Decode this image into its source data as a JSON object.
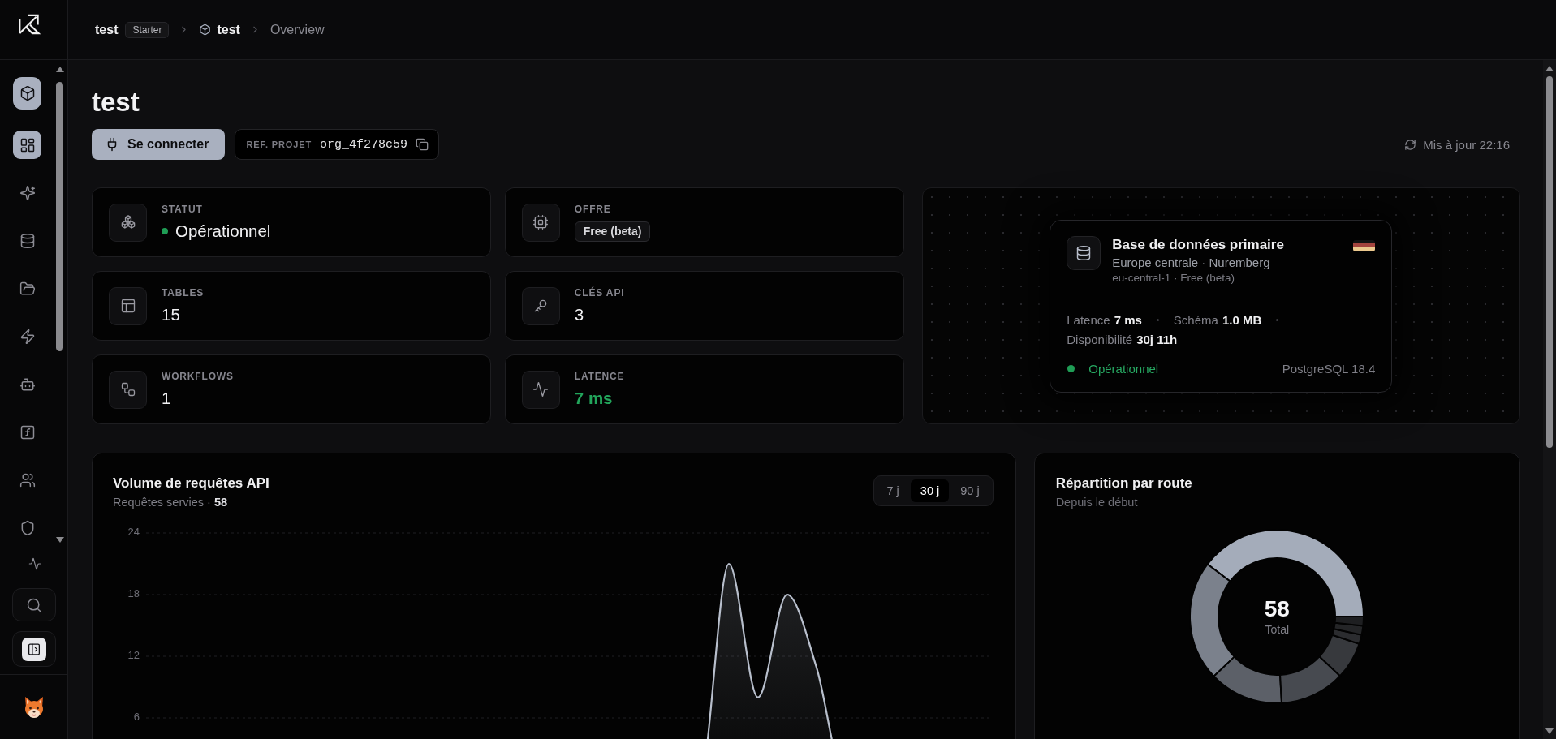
{
  "sidebar": {
    "nav": [
      {
        "selected": true
      },
      {
        "selected": true
      },
      {
        "selected": false
      },
      {
        "selected": false
      },
      {
        "selected": false
      },
      {
        "selected": false
      },
      {
        "selected": false
      },
      {
        "selected": false
      },
      {
        "selected": false
      },
      {
        "selected": false
      }
    ],
    "tools": [
      {
        "kind": "plain",
        "on": false
      },
      {
        "kind": "boxed",
        "on": false
      },
      {
        "kind": "boxed",
        "on": true
      }
    ]
  },
  "header": {
    "breadcrumb": {
      "org": "test",
      "plan": "Starter",
      "project": "test",
      "page": "Overview"
    }
  },
  "page": {
    "title": "test",
    "connect_button": "Se connecter",
    "project_ref": {
      "label": "RÉF. PROJET",
      "value": "org_4f278c59"
    },
    "updated": "Mis à jour 22:16"
  },
  "stats": [
    {
      "label": "STATUT",
      "value": "Opérationnel",
      "kind": "status"
    },
    {
      "label": "OFFRE",
      "value": "Free (beta)",
      "kind": "badge"
    },
    {
      "label": "TABLES",
      "value": "15",
      "kind": "plain"
    },
    {
      "label": "CLÉS API",
      "value": "3",
      "kind": "plain"
    },
    {
      "label": "WORKFLOWS",
      "value": "1",
      "kind": "plain"
    },
    {
      "label": "LATENCE",
      "value": "7 ms",
      "kind": "positive"
    }
  ],
  "database": {
    "title": "Base de données primaire",
    "location": "Europe centrale · Nuremberg",
    "region": "eu-central-1 · Free (beta)",
    "metrics": [
      {
        "label": "Latence",
        "value": "7 ms"
      },
      {
        "label": "Schéma",
        "value": "1.0 MB"
      },
      {
        "label": "Disponibilité",
        "value": "30j 11h"
      }
    ],
    "status": "Opérationnel",
    "engine": "PostgreSQL 18.4"
  },
  "requests_chart": {
    "title": "Volume de requêtes API",
    "subtitle": "Requêtes servies · **58**",
    "ranges": [
      {
        "label": "7 j",
        "selected": false
      },
      {
        "label": "30 j",
        "selected": true
      },
      {
        "label": "90 j",
        "selected": false
      }
    ],
    "chart_data": {
      "type": "area",
      "grid": true,
      "series": [
        {
          "color": "#b8bfcc",
          "values": [
            0,
            0,
            0,
            0,
            0,
            0,
            0,
            0,
            0,
            0,
            0,
            0,
            0,
            0,
            0,
            0,
            0,
            0,
            0,
            0,
            21,
            8,
            18,
            11,
            0,
            0,
            0,
            0,
            0,
            0
          ]
        }
      ],
      "ylim": [
        0,
        24
      ],
      "yticks": [
        6,
        12,
        18,
        24
      ]
    }
  },
  "routes_chart": {
    "title": "Répartition par route",
    "subtitle": "Depuis le début",
    "center_value": "58",
    "center_label": "Total",
    "chart_data": {
      "type": "donut",
      "values": [
        39.7,
        22.4,
        13.8,
        12.1,
        6.9,
        1.7,
        1.7,
        1.7
      ]
    }
  }
}
